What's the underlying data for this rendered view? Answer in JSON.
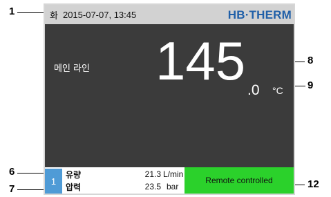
{
  "callouts": {
    "c1": "1",
    "c6": "6",
    "c7": "7",
    "c8": "8",
    "c9": "9",
    "c12": "12"
  },
  "status_bar": {
    "day": "화",
    "datetime": "2015-07-07, 13:45",
    "brand": "HB·THERM",
    "brand_color": "#1f5fa8"
  },
  "main": {
    "label": "메인 라인",
    "value_int": "145",
    "value_dec": ".0",
    "unit": "°C"
  },
  "bottom": {
    "channel": "1",
    "rows": [
      {
        "label": "유량",
        "value": "21.3",
        "unit": "L/min"
      },
      {
        "label": "압력",
        "value": "23.5",
        "unit": "bar"
      }
    ],
    "status": "Remote controlled",
    "status_color": "#2bd12b"
  }
}
